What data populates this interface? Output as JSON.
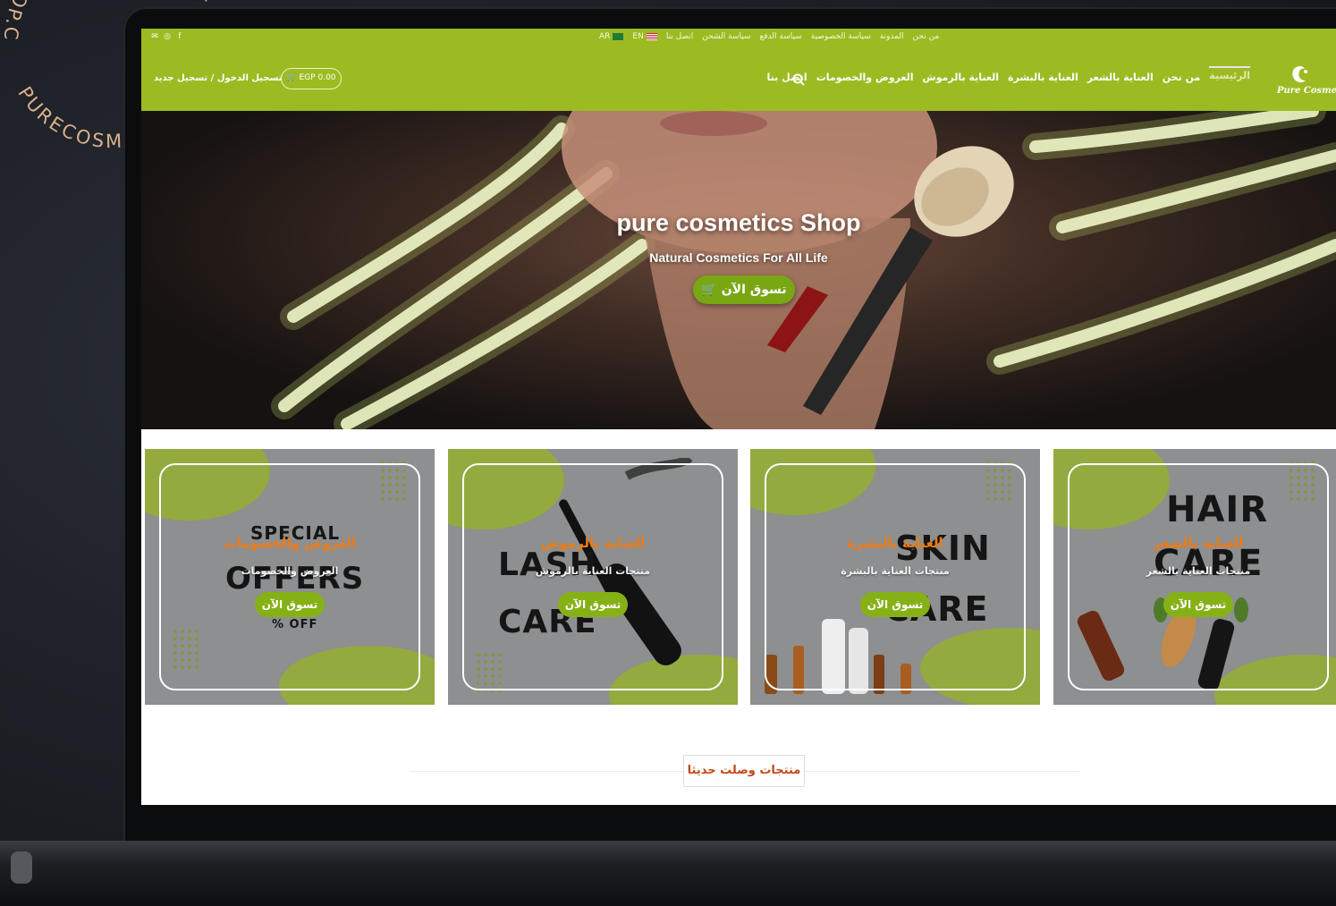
{
  "stamp": {
    "text": "PURECOSMETICSSHOP.COM - PURECOSMETICSSHOP.COM - "
  },
  "colors": {
    "brand_green": "#9cbb22",
    "button_green": "#86b116",
    "accent_orange": "#f07a12",
    "card_gray": "#8d8f90"
  },
  "topbar": {
    "social_icons": [
      "email-icon",
      "instagram-icon",
      "facebook-icon"
    ],
    "links": [
      "AR",
      "EN",
      "اتصل بنا",
      "سياسة الشحن",
      "سياسة الدفع",
      "سياسة الخصوصية",
      "المدونة",
      "من نحن"
    ]
  },
  "nav": {
    "login": "تسجيل الدخول / تسجيل جديد",
    "cart": "EGP 0.00",
    "items": [
      "الرئيسية",
      "من نحن",
      "العناية بالشعر",
      "العناية بالبشرة",
      "العناية بالرموش",
      "العروض والخصومات",
      "اتصل بنا"
    ],
    "brand": "Pure Cosmetics"
  },
  "hero": {
    "title": "pure cosmetics Shop",
    "subtitle": "Natural Cosmetics For All Life",
    "cta": "تسوق الآن"
  },
  "cards": [
    {
      "big1": "SPECIAL",
      "big2": "OFFERS",
      "big3": "% OFF",
      "title": "العروض والخصومات",
      "subtitle": "العروض والخصومات",
      "cta": "تسوق الآن"
    },
    {
      "big1": "LASH",
      "big2": "CARE",
      "title": "العناية بالرموش",
      "subtitle": "منتجات العناية بالرموش",
      "cta": "تسوق الآن"
    },
    {
      "big1": "SKIN",
      "big2": "CARE",
      "title": "العناية بالبشرة",
      "subtitle": "منتجات العناية بالبشرة",
      "cta": "تسوق الآن"
    },
    {
      "big1": "HAIR",
      "big2": "CARE",
      "title": "العناية بالشعر",
      "subtitle": "منتجات العناية بالشعر",
      "cta": "تسوق الآن"
    }
  ],
  "sections": {
    "new_arrivals": "منتجات وصلت حديثا"
  }
}
